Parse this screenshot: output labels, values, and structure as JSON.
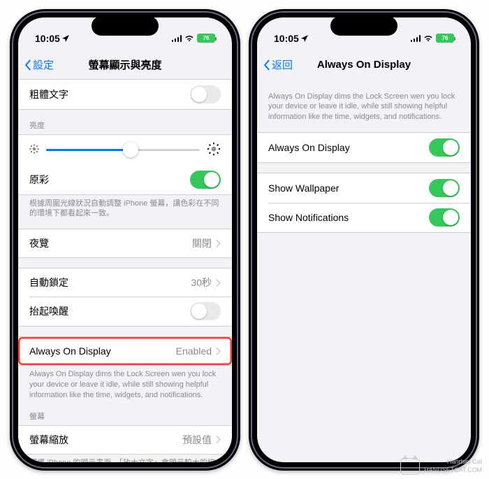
{
  "status": {
    "time": "10:05",
    "battery": "76"
  },
  "left": {
    "nav": {
      "back": "設定",
      "title": "螢幕顯示與亮度"
    },
    "bold_text": {
      "label": "粗體文字",
      "on": false
    },
    "brightness": {
      "header": "亮度"
    },
    "true_tone": {
      "label": "原彩",
      "on": true,
      "footer": "根據周圍光線狀況自動調整 iPhone 螢幕，讓色彩在不同的環境下都看起來一致。"
    },
    "night_shift": {
      "label": "夜覽",
      "value": "關閉"
    },
    "auto_lock": {
      "label": "自動鎖定",
      "value": "30秒"
    },
    "raise_to_wake": {
      "label": "抬起喚醒",
      "on": false
    },
    "aod": {
      "label": "Always On Display",
      "value": "Enabled",
      "footer": "Always On Display dims the Lock Screen wen you lock your device or leave it idle, while still showing helpful information like the time, widgets, and notifications."
    },
    "display": {
      "header": "螢幕",
      "zoom_label": "螢幕縮放",
      "zoom_value": "預設值",
      "footer": "選擇 iPhone 的顯示畫面。「放大文字」會顯示較大的控制項目。「預設值」可顯示較多內容。"
    }
  },
  "right": {
    "nav": {
      "back": "返回",
      "title": "Always On Display"
    },
    "intro": "Always On Display dims the Lock Screen wen you lock your device or leave it idle, while still showing helpful information like the time, widgets, and notifications.",
    "aod": {
      "label": "Always On Display",
      "on": true
    },
    "wallpaper": {
      "label": "Show Wallpaper",
      "on": true
    },
    "notifications": {
      "label": "Show Notifications",
      "on": true
    }
  },
  "watermark": {
    "brand": "Handset Cat",
    "url": "HANDSETCAT.COM"
  }
}
